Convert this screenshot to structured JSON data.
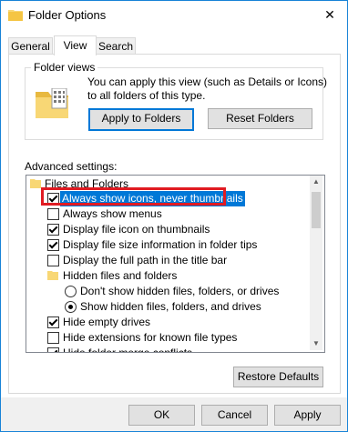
{
  "window": {
    "title": "Folder Options",
    "close_glyph": "✕"
  },
  "tabs": [
    {
      "label": "General"
    },
    {
      "label": "View",
      "active": true
    },
    {
      "label": "Search"
    }
  ],
  "folder_views": {
    "group_label": "Folder views",
    "description": "You can apply this view (such as Details or Icons) to all folders of this type.",
    "apply_button": "Apply to Folders",
    "reset_button": "Reset Folders"
  },
  "advanced": {
    "label": "Advanced settings:",
    "items": [
      {
        "type": "folder",
        "label": "Files and Folders"
      },
      {
        "type": "checkbox",
        "label": "Always show icons, never thumbnails",
        "checked": true,
        "selected": true
      },
      {
        "type": "checkbox",
        "label": "Always show menus",
        "checked": false
      },
      {
        "type": "checkbox",
        "label": "Display file icon on thumbnails",
        "checked": true
      },
      {
        "type": "checkbox",
        "label": "Display file size information in folder tips",
        "checked": true
      },
      {
        "type": "checkbox",
        "label": "Display the full path in the title bar",
        "checked": false
      },
      {
        "type": "folder",
        "label": "Hidden files and folders"
      },
      {
        "type": "radio",
        "label": "Don't show hidden files, folders, or drives",
        "on": false
      },
      {
        "type": "radio",
        "label": "Show hidden files, folders, and drives",
        "on": true
      },
      {
        "type": "checkbox",
        "label": "Hide empty drives",
        "checked": true
      },
      {
        "type": "checkbox",
        "label": "Hide extensions for known file types",
        "checked": false
      },
      {
        "type": "checkbox",
        "label": "Hide folder merge conflicts",
        "checked": true
      }
    ],
    "restore_button": "Restore Defaults"
  },
  "footer": {
    "ok": "OK",
    "cancel": "Cancel",
    "apply": "Apply"
  },
  "colors": {
    "accent": "#0078d7",
    "highlight": "#e11b22"
  }
}
